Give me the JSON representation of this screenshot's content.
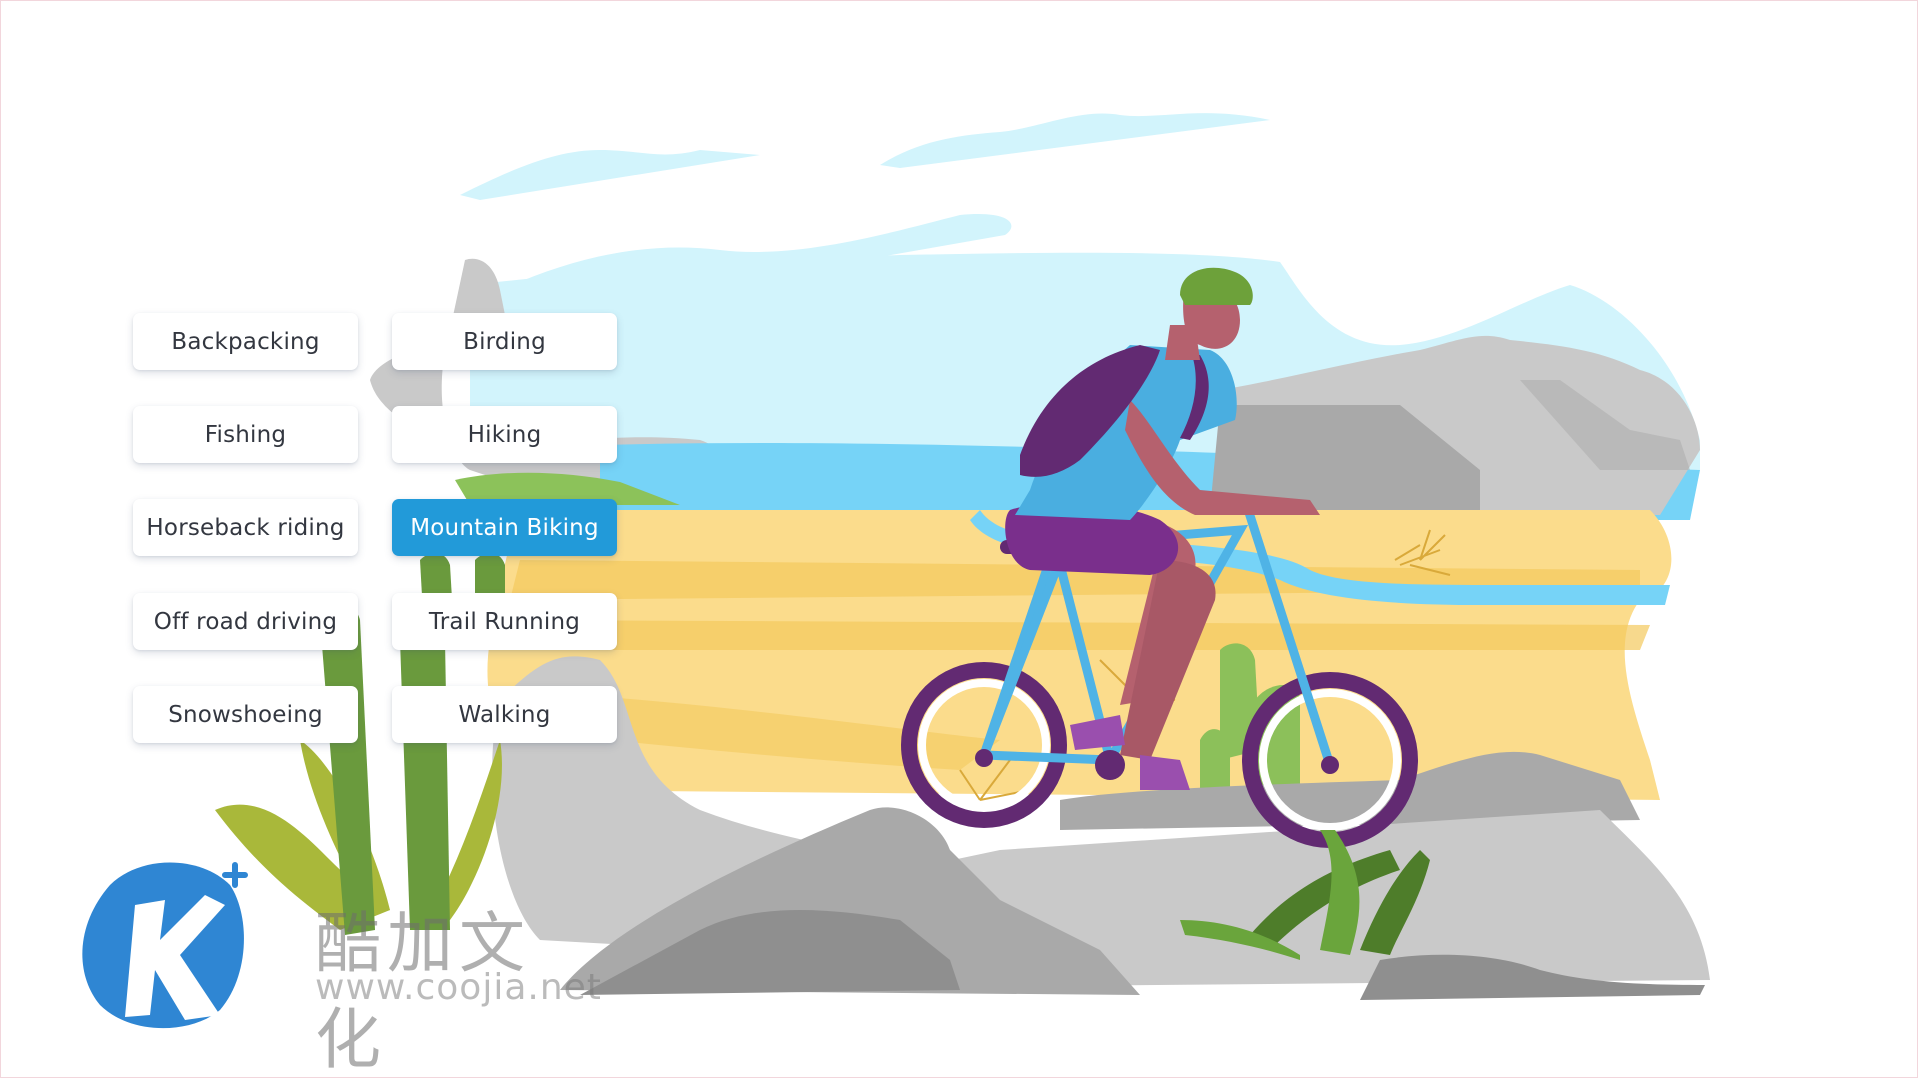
{
  "activities": [
    {
      "label": "Backpacking",
      "selected": false
    },
    {
      "label": "Birding",
      "selected": false
    },
    {
      "label": "Fishing",
      "selected": false
    },
    {
      "label": "Hiking",
      "selected": false
    },
    {
      "label": "Horseback riding",
      "selected": false
    },
    {
      "label": "Mountain Biking",
      "selected": true
    },
    {
      "label": "Off road driving",
      "selected": false
    },
    {
      "label": "Trail Running",
      "selected": false
    },
    {
      "label": "Snowshoeing",
      "selected": false
    },
    {
      "label": "Walking",
      "selected": false
    }
  ],
  "colors": {
    "selected_bg": "#229ad9",
    "chip_bg": "#ffffff",
    "chip_text": "#333740",
    "sky": "#d2f4fc",
    "sand": "#fbdc8c",
    "sand_dark": "#f4c95d",
    "water": "#76d3f7",
    "rock_light": "#c9c9c9",
    "rock_mid": "#a9a9a9",
    "rock_dark": "#8f8f8f",
    "bike_frame": "#4fb3e6",
    "wheel": "#622a72",
    "shirt": "#4aaee0",
    "shorts": "#7a2f8c",
    "skin": "#b5616e",
    "helmet": "#6da13a",
    "cactus": "#6a9a3d",
    "watermark_blue": "#2f86d3"
  },
  "illustration": {
    "subject": "cyclist riding a mountain bike through a desert landscape"
  },
  "watermark": {
    "brand_cn": "酷加文化",
    "url": "www.coojia.net",
    "logo_letter": "K"
  }
}
